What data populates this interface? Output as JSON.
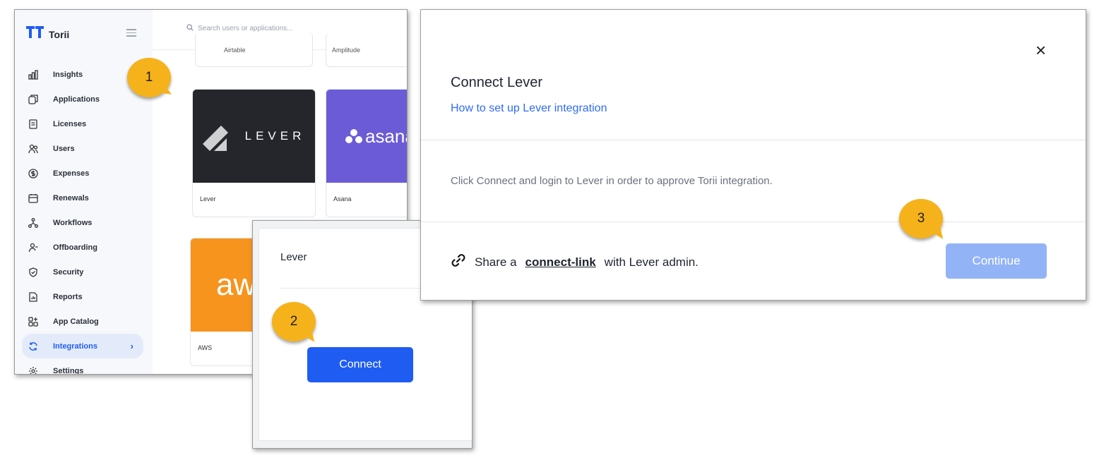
{
  "app": {
    "brand": "Torii",
    "search_placeholder": "Search users or applications...",
    "nav": [
      {
        "label": "Insights",
        "icon": "chart-icon"
      },
      {
        "label": "Applications",
        "icon": "applications-icon"
      },
      {
        "label": "Licenses",
        "icon": "license-icon"
      },
      {
        "label": "Users",
        "icon": "users-icon"
      },
      {
        "label": "Expenses",
        "icon": "dollar-icon"
      },
      {
        "label": "Renewals",
        "icon": "calendar-icon"
      },
      {
        "label": "Workflows",
        "icon": "workflow-icon"
      },
      {
        "label": "Offboarding",
        "icon": "offboarding-icon"
      },
      {
        "label": "Security",
        "icon": "shield-icon"
      },
      {
        "label": "Reports",
        "icon": "report-icon"
      },
      {
        "label": "App Catalog",
        "icon": "catalog-icon"
      },
      {
        "label": "Integrations",
        "icon": "sync-icon",
        "active": true
      },
      {
        "label": "Settings",
        "icon": "gear-icon"
      }
    ],
    "cards": {
      "top_left": "Airtable",
      "top_right": "Amplitude",
      "lever_logo": "LEVER",
      "lever_name": "Lever",
      "asana_logo": "asana",
      "asana_name": "Asana",
      "aws_logo": "aws",
      "aws_name": "AWS"
    }
  },
  "connect_panel": {
    "title": "Lever",
    "button": "Connect"
  },
  "dialog": {
    "close": "×",
    "title": "Connect Lever",
    "link": "How to set up Lever integration",
    "body": "Click Connect and login to Lever in order to approve Torii integration.",
    "share_prefix": "Share a",
    "share_link": "connect-link",
    "share_suffix": "with Lever admin.",
    "continue_button": "Continue"
  },
  "steps": [
    "1",
    "2",
    "3"
  ],
  "colors": {
    "primary": "#1f5cf2",
    "primary_disabled": "#93b3f7",
    "bubble": "#f5b21b",
    "lever_bg": "#25262c",
    "asana_bg": "#6b5bd6",
    "aws_bg": "#f7941e"
  }
}
